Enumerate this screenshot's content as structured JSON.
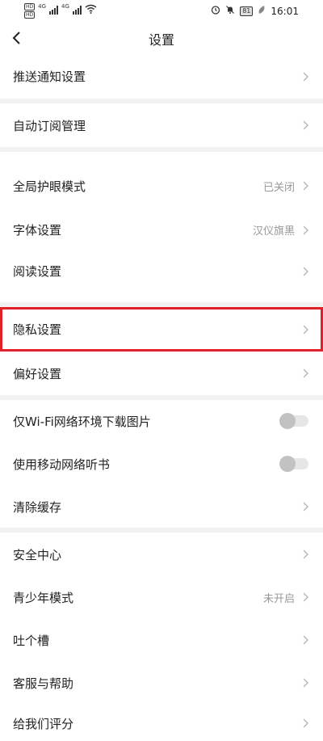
{
  "status": {
    "hd1": "HD",
    "net1": "4G",
    "hd2": "HD",
    "net2": "4G",
    "battery": "81",
    "time": "16:01"
  },
  "header": {
    "title": "设置"
  },
  "rows": {
    "push": {
      "label": "推送通知设置"
    },
    "auto": {
      "label": "自动订阅管理"
    },
    "eye": {
      "label": "全局护眼模式",
      "value": "已关闭"
    },
    "font": {
      "label": "字体设置",
      "value": "汉仪旗黑"
    },
    "read": {
      "label": "阅读设置"
    },
    "privacy": {
      "label": "隐私设置"
    },
    "pref": {
      "label": "偏好设置"
    },
    "wifi": {
      "label": "仅Wi-Fi网络环境下载图片",
      "enabled": false
    },
    "mobile": {
      "label": "使用移动网络听书",
      "enabled": false
    },
    "cache": {
      "label": "清除缓存"
    },
    "safety": {
      "label": "安全中心"
    },
    "youth": {
      "label": "青少年模式",
      "value": "未开启"
    },
    "feedback": {
      "label": "吐个槽"
    },
    "service": {
      "label": "客服与帮助"
    },
    "rate": {
      "label": "给我们评分"
    }
  },
  "icons": {
    "back": "chevron-left-icon",
    "chevron": "chevron-right-icon",
    "alarm": "alarm-icon",
    "mute": "bell-off-icon",
    "leaf": "leaf-icon",
    "wifi": "wifi-icon"
  },
  "colors": {
    "highlight": "#e12028",
    "separator": "#f2f2f2",
    "value": "#999999"
  }
}
